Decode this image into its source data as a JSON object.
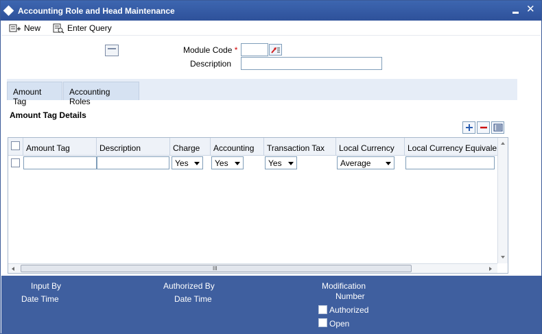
{
  "window": {
    "title": "Accounting Role and Head Maintenance"
  },
  "toolbar": {
    "new_label": "New",
    "enter_query_label": "Enter Query"
  },
  "header": {
    "module_code_label": "Module Code",
    "required_mark": "*",
    "module_code_value": "",
    "description_label": "Description",
    "description_value": ""
  },
  "tabs": [
    {
      "label": "Amount Tag",
      "active": true
    },
    {
      "label": "Accounting Roles",
      "active": false
    }
  ],
  "section": {
    "title": "Amount Tag Details"
  },
  "grid": {
    "columns": [
      "Amount Tag",
      "Description",
      "Charge",
      "Accounting",
      "Transaction Tax",
      "Local Currency",
      "Local Currency Equivalent"
    ],
    "rows": [
      {
        "amount_tag": "",
        "description": "",
        "charge": "Yes",
        "accounting": "Yes",
        "transaction_tax": "Yes",
        "local_currency": "Average",
        "local_currency_equivalent": ""
      }
    ],
    "scroll_grip": "III"
  },
  "footer": {
    "input_by": "Input By",
    "date_time_1": "Date Time",
    "authorized_by": "Authorized By",
    "date_time_2": "Date Time",
    "modification": "Modification",
    "number": "Number",
    "authorized": "Authorized",
    "open": "Open"
  },
  "colors": {
    "titlebar": "#3d66b0",
    "footer": "#3f5f9f",
    "tabstrip": "#e6edf7",
    "required": "#d00000"
  }
}
